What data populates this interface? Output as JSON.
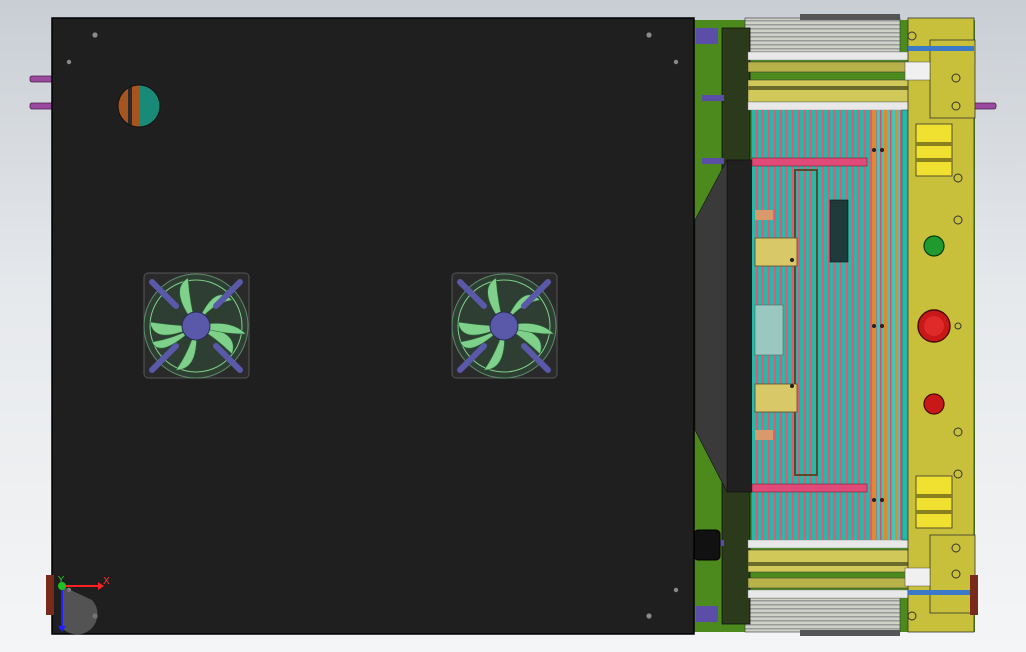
{
  "triad": {
    "x_label": "X",
    "y_label": "Y"
  },
  "colors": {
    "cover": "#1f1f1f",
    "frame_olive": "#c8c03a",
    "fan_blade": "#7fd08a",
    "fan_hub": "#5a58a8",
    "button_green": "#1e9a2e",
    "button_red": "#c81818",
    "teal": "#24b8a8",
    "pink": "#e05a78"
  },
  "icons": [
    "fan-icon",
    "indicator-light-green",
    "emergency-stop-button-red",
    "indicator-light-red",
    "coordinate-triad-icon"
  ]
}
